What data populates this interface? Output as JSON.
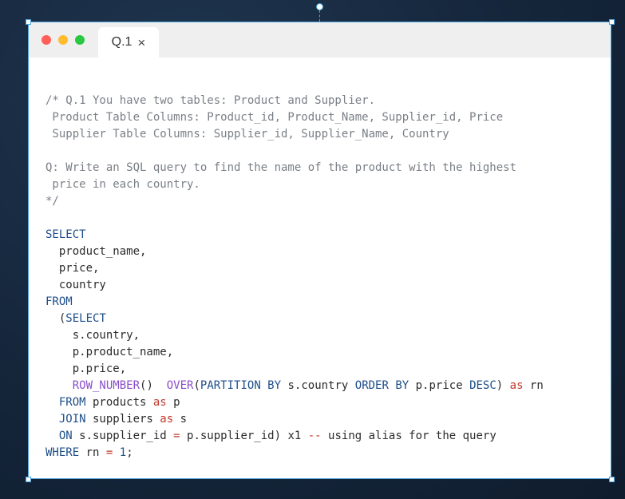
{
  "tab": {
    "title": "Q.1",
    "close_glyph": "×"
  },
  "window_controls": [
    "close-dot",
    "minimize-dot",
    "maximize-dot"
  ],
  "colors": {
    "comment": "#7a7f86",
    "keyword": "#1d4e89",
    "function": "#8a4fc9",
    "operator": "#c0392b",
    "plain": "#2b2b2b",
    "background": "#15263b"
  },
  "code_lines": [
    [
      [
        "cm",
        "/* Q.1 You have two tables: Product and Supplier."
      ]
    ],
    [
      [
        "cm",
        " Product Table Columns: Product_id, Product_Name, Supplier_id, Price"
      ]
    ],
    [
      [
        "cm",
        " Supplier Table Columns: Supplier_id, Supplier_Name, Country"
      ]
    ],
    [],
    [
      [
        "cm",
        "Q: Write an SQL query to find the name of the product with the highest"
      ]
    ],
    [
      [
        "cm",
        " price in each country."
      ]
    ],
    [
      [
        "cm",
        "*/"
      ]
    ],
    [],
    [
      [
        "kw",
        "SELECT"
      ]
    ],
    [
      [
        "pl",
        "  product_name,"
      ]
    ],
    [
      [
        "pl",
        "  price,"
      ]
    ],
    [
      [
        "pl",
        "  country"
      ]
    ],
    [
      [
        "kw",
        "FROM"
      ]
    ],
    [
      [
        "pl",
        "  ("
      ],
      [
        "kw",
        "SELECT"
      ]
    ],
    [
      [
        "pl",
        "    s.country,"
      ]
    ],
    [
      [
        "pl",
        "    p.product_name,"
      ]
    ],
    [
      [
        "pl",
        "    p.price,"
      ]
    ],
    [
      [
        "fn",
        "    ROW_NUMBER"
      ],
      [
        "pl",
        "()  "
      ],
      [
        "fn",
        "OVER"
      ],
      [
        "pl",
        "("
      ],
      [
        "kw",
        "PARTITION BY"
      ],
      [
        "pl",
        " s.country "
      ],
      [
        "kw",
        "ORDER BY"
      ],
      [
        "pl",
        " p.price "
      ],
      [
        "kw",
        "DESC"
      ],
      [
        "pl",
        ") "
      ],
      [
        "op",
        "as"
      ],
      [
        "pl",
        " rn"
      ]
    ],
    [
      [
        "kw",
        "  FROM"
      ],
      [
        "pl",
        " products "
      ],
      [
        "op",
        "as"
      ],
      [
        "pl",
        " p"
      ]
    ],
    [
      [
        "kw",
        "  JOIN"
      ],
      [
        "pl",
        " suppliers "
      ],
      [
        "op",
        "as"
      ],
      [
        "pl",
        " s"
      ]
    ],
    [
      [
        "kw",
        "  ON"
      ],
      [
        "pl",
        " s.supplier_id "
      ],
      [
        "op",
        "="
      ],
      [
        "pl",
        " p.supplier_id) x1 "
      ],
      [
        "op",
        "--"
      ],
      [
        "pl",
        " using alias for the query"
      ]
    ],
    [
      [
        "kw",
        "WHERE"
      ],
      [
        "pl",
        " rn "
      ],
      [
        "op",
        "="
      ],
      [
        "pl",
        " "
      ],
      [
        "num",
        "1"
      ],
      [
        "pl",
        ";"
      ]
    ]
  ]
}
